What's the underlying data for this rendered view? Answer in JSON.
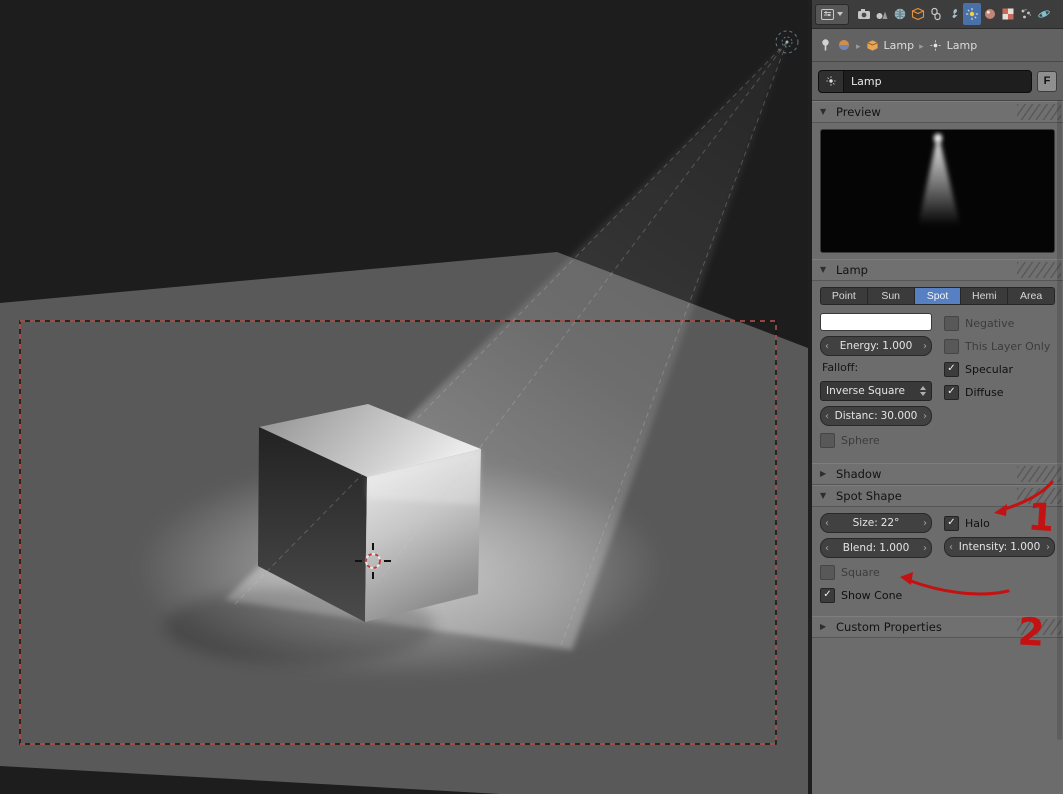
{
  "properties": {
    "tabs": [
      "render",
      "scene",
      "world",
      "object",
      "constraints",
      "modifiers",
      "object-data",
      "material",
      "texture",
      "particles",
      "physics"
    ],
    "active_tab": "object-data",
    "breadcrumb": {
      "object": "Lamp",
      "data": "Lamp"
    },
    "name_field": {
      "value": "Lamp"
    },
    "fake_user_button": "F",
    "preview": {
      "title": "Preview"
    },
    "lamp": {
      "title": "Lamp",
      "types": [
        "Point",
        "Sun",
        "Spot",
        "Hemi",
        "Area"
      ],
      "active_type": "Spot",
      "color_swatch": "#ffffff",
      "energy_label": "Energy:",
      "energy_value": "1.000",
      "negative": "Negative",
      "negative_checked": false,
      "this_layer_only": "This Layer Only",
      "this_layer_only_checked": false,
      "specular": "Specular",
      "specular_checked": true,
      "diffuse": "Diffuse",
      "diffuse_checked": true,
      "falloff_label": "Falloff:",
      "falloff_value": "Inverse Square",
      "distance_label": "Distanc:",
      "distance_value": "30.000",
      "sphere": "Sphere",
      "sphere_checked": false
    },
    "shadow": {
      "title": "Shadow"
    },
    "spot_shape": {
      "title": "Spot Shape",
      "size_label": "Size:",
      "size_value": "22°",
      "halo": "Halo",
      "halo_checked": true,
      "blend_label": "Blend:",
      "blend_value": "1.000",
      "intensity_label": "Intensity:",
      "intensity_value": "1.000",
      "square": "Square",
      "square_checked": false,
      "show_cone": "Show Cone",
      "show_cone_checked": true
    },
    "custom_properties": {
      "title": "Custom Properties"
    }
  },
  "annotations": {
    "marker_1": "1",
    "marker_2": "2"
  },
  "colors": {
    "accent_blue": "#5680c2",
    "annotation_red": "#c41212",
    "camera_border": "#c0564f",
    "viewport_background": "#1d1d1d",
    "floor": "#595959",
    "panel_background": "#6c6c6c"
  }
}
